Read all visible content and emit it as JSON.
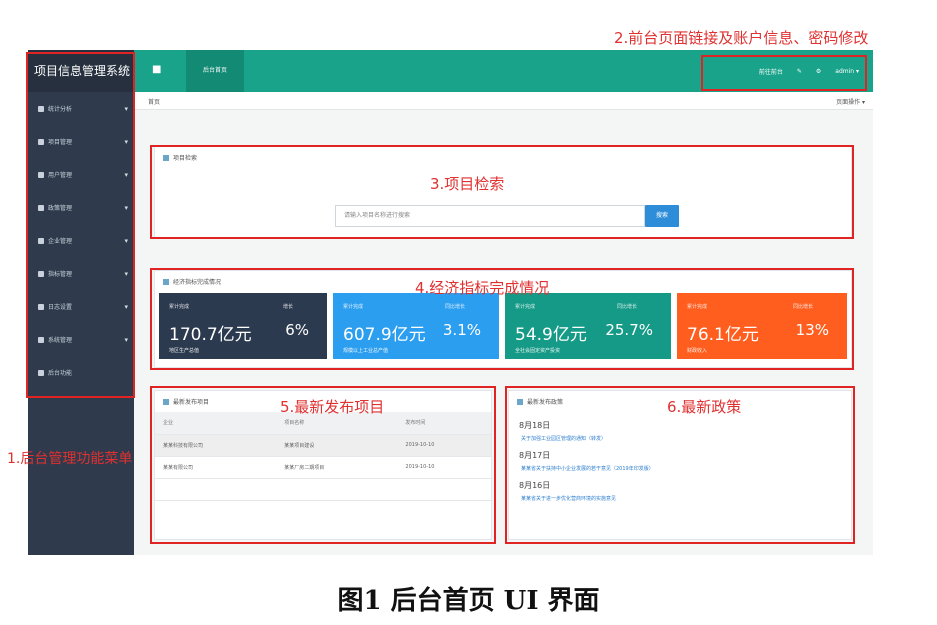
{
  "sidebar": {
    "title": "项目信息管理系统",
    "items": [
      {
        "label": "统计分析",
        "icon": "chart-icon"
      },
      {
        "label": "项目管理",
        "icon": "folder-icon"
      },
      {
        "label": "用户管理",
        "icon": "user-icon"
      },
      {
        "label": "政策管理",
        "icon": "doc-icon"
      },
      {
        "label": "企业管理",
        "icon": "building-icon"
      },
      {
        "label": "指标管理",
        "icon": "list-icon"
      },
      {
        "label": "日志设置",
        "icon": "log-icon"
      },
      {
        "label": "系统管理",
        "icon": "gear-icon"
      },
      {
        "label": "后台功能",
        "icon": "power-icon"
      }
    ]
  },
  "topbar": {
    "tab": "后台首页",
    "links": [
      "前往前台",
      "✎",
      "⚙",
      "admin ▾"
    ]
  },
  "crumb": {
    "left": "首页",
    "right": "页面操作 ▾"
  },
  "search_panel": {
    "title": "项目检索",
    "placeholder": "请输入项目名称进行搜索",
    "button": "搜索"
  },
  "stats_panel": {
    "title": "经济指标完成情况",
    "cards": [
      {
        "label": "累计完成",
        "value": "170.7亿元",
        "desc": "地区生产总值",
        "rlabel": "增长",
        "rvalue": "6%",
        "color": "#2c3a4f"
      },
      {
        "label": "累计完成",
        "value": "607.9亿元",
        "desc": "规模以上工业总产值",
        "rlabel": "同比增长",
        "rvalue": "3.1%",
        "color": "#2c9ef0"
      },
      {
        "label": "累计完成",
        "value": "54.9亿元",
        "desc": "全社会固定资产投资",
        "rlabel": "同比增长",
        "rvalue": "25.7%",
        "color": "#149a86"
      },
      {
        "label": "累计完成",
        "value": "76.1亿元",
        "desc": "财政收入",
        "rlabel": "同比增长",
        "rvalue": "13%",
        "color": "#ff5e1f"
      }
    ]
  },
  "projects_panel": {
    "title": "最新发布项目",
    "columns": [
      "企业",
      "项目名称",
      "发布时间"
    ],
    "rows": [
      [
        "某某科技有限公司",
        "某某项目建设",
        "2019-10-10"
      ],
      [
        "某某有限公司",
        "某某厂房二期项目",
        "2019-10-10"
      ],
      [
        "",
        "",
        ""
      ]
    ]
  },
  "policy_panel": {
    "title": "最新发布政策",
    "items": [
      {
        "date": "8月18日",
        "link": "关于加强工业园区管理的通知（转发）"
      },
      {
        "date": "8月17日",
        "link": "某某省关于扶持中小企业发展的若干意见（2019年印发版）"
      },
      {
        "date": "8月16日",
        "link": "某某省关于进一步优化营商环境的实施意见"
      }
    ]
  },
  "annotations": {
    "a1": "1.后台管理功能菜单",
    "a2": "2.前台页面链接及账户信息、密码修改",
    "a3": "3.项目检索",
    "a4": "4.经济指标完成情况",
    "a5": "5.最新发布项目",
    "a6": "6.最新政策"
  },
  "caption": "图1  后台首页 UI 界面"
}
